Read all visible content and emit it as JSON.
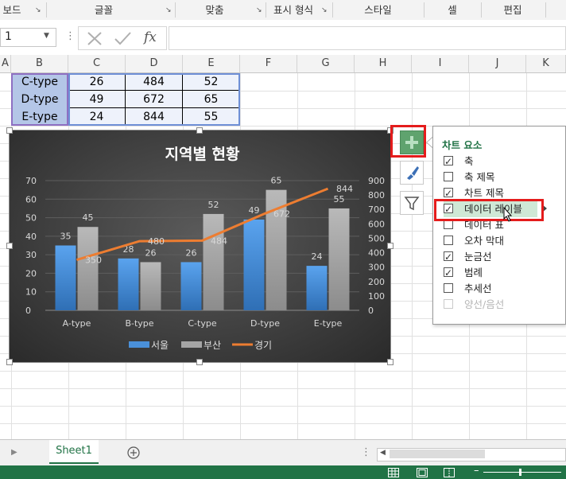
{
  "ribbon": {
    "groups": [
      "보드",
      "글꼴",
      "맞춤",
      "표시 형식",
      "스타일",
      "셀",
      "편집"
    ]
  },
  "formula_bar": {
    "name_box_value": "1",
    "fx_label": "fx",
    "formula_value": ""
  },
  "columns": [
    "A",
    "B",
    "C",
    "D",
    "E",
    "F",
    "G",
    "H",
    "I",
    "J",
    "K"
  ],
  "table_rows": [
    {
      "name": "C-type",
      "c": "26",
      "d": "484",
      "e": "52"
    },
    {
      "name": "D-type",
      "c": "49",
      "d": "672",
      "e": "65"
    },
    {
      "name": "E-type",
      "c": "24",
      "d": "844",
      "e": "55"
    }
  ],
  "chart_data": {
    "type": "bar",
    "title": "지역별 현황",
    "categories": [
      "A-type",
      "B-type",
      "C-type",
      "D-type",
      "E-type"
    ],
    "series": [
      {
        "name": "서울",
        "type": "bar",
        "axis": "left",
        "values": [
          35,
          28,
          26,
          49,
          24
        ],
        "color": "#4a90d9"
      },
      {
        "name": "부산",
        "type": "bar",
        "axis": "left",
        "values": [
          45,
          26,
          52,
          65,
          55
        ],
        "color": "#a5a5a5"
      },
      {
        "name": "경기",
        "type": "line",
        "axis": "right",
        "values": [
          350,
          480,
          484,
          672,
          844
        ],
        "color": "#ed7d31"
      }
    ],
    "ylim": [
      0,
      70
    ],
    "y_ticks": [
      "0",
      "10",
      "20",
      "30",
      "40",
      "50",
      "60",
      "70"
    ],
    "y2lim": [
      0,
      900
    ],
    "y2_ticks": [
      "0",
      "100",
      "200",
      "300",
      "400",
      "500",
      "600",
      "700",
      "800",
      "900"
    ],
    "legend": "bottom",
    "grid": true
  },
  "chart_panel": {
    "title": "차트 요소",
    "items": [
      {
        "label": "축",
        "checked": true,
        "disabled": false
      },
      {
        "label": "축 제목",
        "checked": false,
        "disabled": false
      },
      {
        "label": "차트 제목",
        "checked": true,
        "disabled": false
      },
      {
        "label": "데이터 레이블",
        "checked": true,
        "disabled": false,
        "highlighted": true
      },
      {
        "label": "데이터 표",
        "checked": false,
        "disabled": false
      },
      {
        "label": "오차 막대",
        "checked": false,
        "disabled": false
      },
      {
        "label": "눈금선",
        "checked": true,
        "disabled": false
      },
      {
        "label": "범례",
        "checked": true,
        "disabled": false
      },
      {
        "label": "추세선",
        "checked": false,
        "disabled": false
      },
      {
        "label": "양선/음선",
        "checked": false,
        "disabled": true
      }
    ]
  },
  "side_buttons": [
    "chart-elements-plus-icon",
    "chart-styles-brush-icon",
    "chart-filter-icon"
  ],
  "sheet_tabs": [
    "Sheet1"
  ],
  "colors": {
    "excel_green": "#217346",
    "highlight_red": "#e41c1c"
  }
}
